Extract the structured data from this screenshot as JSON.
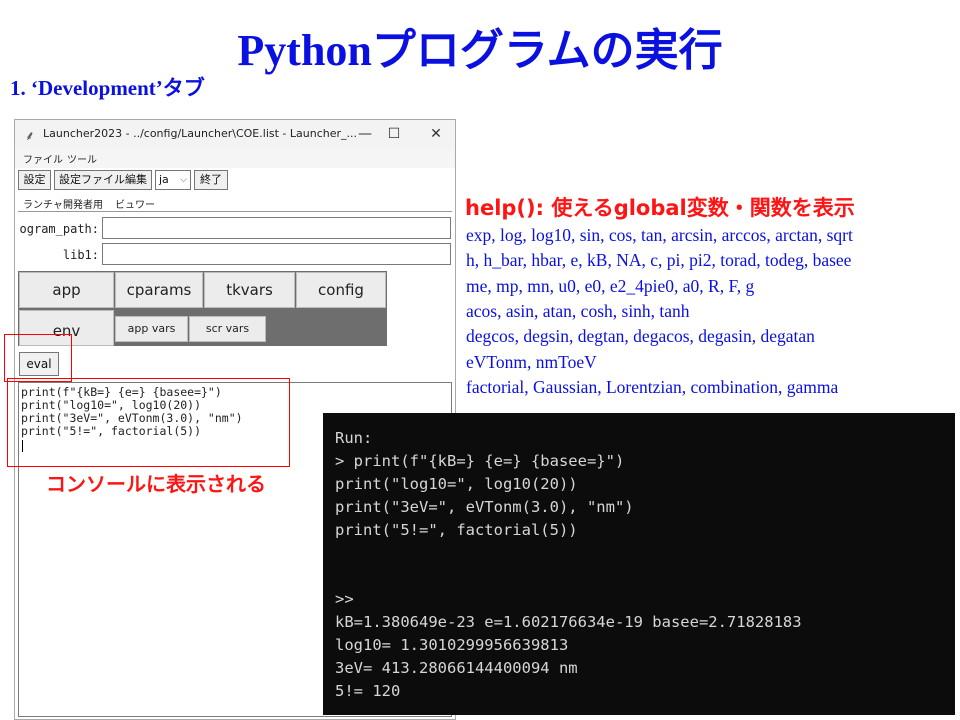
{
  "slide": {
    "title": "Pythonプログラムの実行",
    "subtitle": "1. ‘Development’タブ"
  },
  "window": {
    "title": "Launcher2023 - ../config/Launcher\\COE.list - Launcher_...",
    "controls": {
      "minimize": "—",
      "maximize": "☐",
      "close": "✕"
    },
    "menu": [
      "ファイル",
      "ツール"
    ],
    "toolbar": {
      "settings": "設定",
      "edit_settings_file": "設定ファイル編集",
      "lang": "ja",
      "lang_arrow": "⌵",
      "exit": "終了"
    },
    "tabs": [
      "ランチャ",
      "開発者用",
      "ビュワー"
    ],
    "fields": {
      "program_path_label": "ogram_path:",
      "lib1_label": "lib1:"
    },
    "buttons": {
      "app": "app",
      "cparams": "cparams",
      "tkvars": "tkvars",
      "config": "config",
      "env": "env",
      "app_vars": "app vars",
      "scr_vars": "scr vars",
      "eval": "eval"
    },
    "code": [
      "print(f\"{kB=} {e=} {basee=}\")",
      "print(\"log10=\", log10(20))",
      "print(\"3eV=\", eVTonm(3.0), \"nm\")",
      "print(\"5!=\", factorial(5))"
    ]
  },
  "annotation": {
    "console_label": "コンソールに表示される"
  },
  "help": {
    "title": "help(): 使えるglobal変数・関数を表示",
    "lines": [
      "exp, log, log10, sin, cos, tan, arcsin, arccos, arctan, sqrt",
      "h, h_bar, hbar, e, kB, NA, c, pi, pi2, torad, todeg, basee",
      "me, mp, mn, u0, e0, e2_4pie0, a0, R, F, g",
      "acos, asin, atan, cosh, sinh, tanh",
      "degcos, degsin, degtan, degacos, degasin, degatan",
      "eVTonm, nmToeV",
      "factorial, Gaussian, Lorentzian, combination, gamma"
    ]
  },
  "terminal": {
    "lines": [
      "Run:",
      "> print(f\"{kB=} {e=} {basee=}\")",
      "print(\"log10=\", log10(20))",
      "print(\"3eV=\", eVTonm(3.0), \"nm\")",
      "print(\"5!=\", factorial(5))",
      "",
      "",
      ">>",
      "kB=1.380649e-23 e=1.602176634e-19 basee=2.71828183",
      "log10= 1.3010299956639813",
      "3eV= 413.28066144400094 nm",
      "5!= 120"
    ]
  }
}
